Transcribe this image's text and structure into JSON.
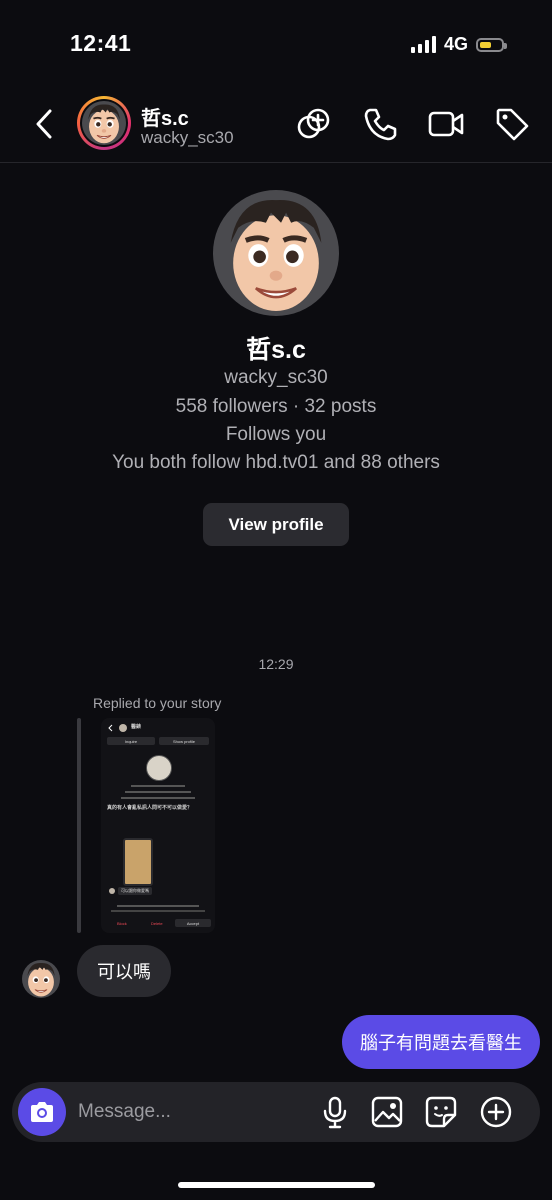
{
  "status_bar": {
    "time": "12:41",
    "network": "4G"
  },
  "header": {
    "name": "哲s.c",
    "username": "wacky_sc30",
    "icons": [
      "add-effects-icon",
      "phone-icon",
      "video-icon",
      "tag-icon"
    ]
  },
  "profile": {
    "name": "哲s.c",
    "username": "wacky_sc30",
    "stats": "558 followers · 32 posts",
    "follows_you": "Follows you",
    "mutual": "You both follow hbd.tv01 and 88 others",
    "view_profile_label": "View profile"
  },
  "conversation": {
    "timestamp": "12:29",
    "story_reply_label": "Replied to your story",
    "story_preview": {
      "title": "醫錶",
      "btn_left": "Inquire",
      "btn_right": "Show profile",
      "question": "真的有人會亂私訊人問可不可以做愛？",
      "reply": "可以跟你做愛嗎",
      "block": "Block",
      "delete": "Delete",
      "accept": "Accept"
    },
    "incoming_message": "可以嗎",
    "outgoing_message": "腦子有問題去看醫生"
  },
  "composer": {
    "placeholder": "Message..."
  },
  "colors": {
    "accent": "#5b4be6",
    "background": "#0c0c10",
    "bubble_in": "#2a2a2f"
  }
}
